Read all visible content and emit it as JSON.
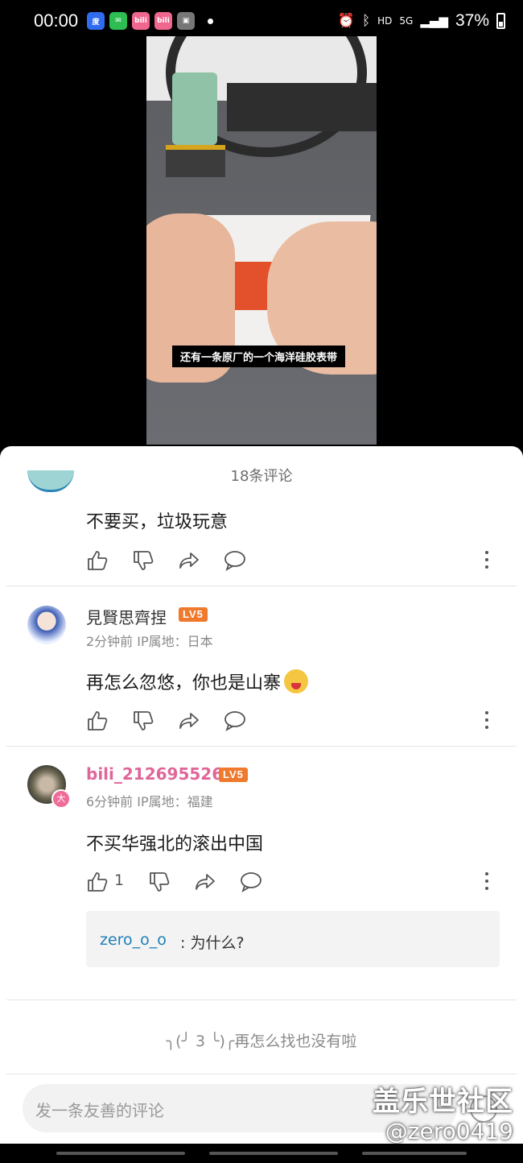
{
  "status_bar": {
    "time": "00:00",
    "net": "HD",
    "signal": "5G",
    "battery": "37%",
    "apps": [
      "baidu-icon",
      "wechat-icon",
      "bilibili-icon",
      "bilibili-icon",
      "gallery-icon"
    ]
  },
  "video": {
    "subtitle": "还有一条原厂的一个海洋硅胶表带"
  },
  "comments_panel": {
    "title": "18条评论",
    "comments": [
      {
        "text": "不要买，垃圾玩意"
      },
      {
        "username": "見賢思齊捏",
        "level": "LV5",
        "meta": "2分钟前  IP属地：日本",
        "text": "再怎么忽悠，你也是山寨"
      },
      {
        "username": "bili_212695526",
        "level": "LV5",
        "meta": "6分钟前  IP属地：福建",
        "text": "不买华强北的滚出中国",
        "likes": "1",
        "badge": "大",
        "reply": {
          "user": "zero_o_o",
          "text": ": 为什么?"
        }
      }
    ],
    "end_text": "╮(╯ 3 ╰)╭再怎么找也没有啦"
  },
  "input": {
    "placeholder": "发一条友善的评论"
  },
  "watermark": {
    "line1": "盖乐世社区",
    "line2": "@zero0419"
  },
  "colors": {
    "level_badge": "#ef7a2e",
    "vip_name": "#e0669a",
    "reply_user": "#1e7fb6"
  }
}
